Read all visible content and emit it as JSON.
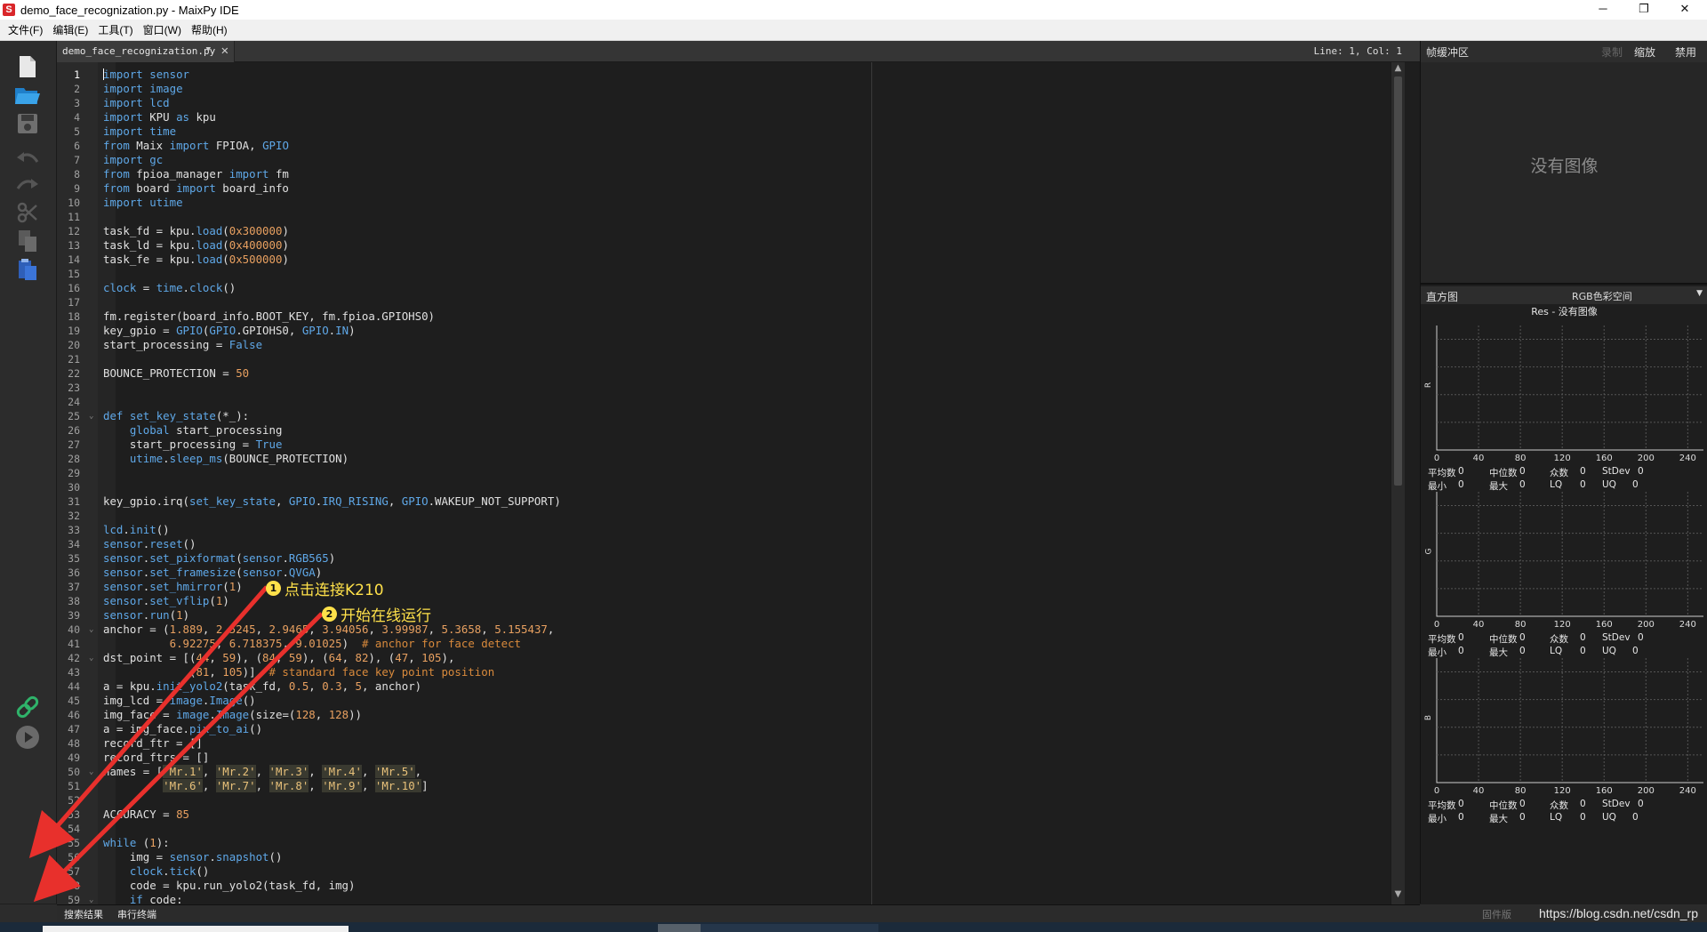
{
  "window": {
    "title": "demo_face_recognization.py - MaixPy IDE",
    "app_icon": "S",
    "minimize": "─",
    "restore": "❐",
    "close": "✕"
  },
  "menu": [
    "文件(F)",
    "编辑(E)",
    "工具(T)",
    "窗口(W)",
    "帮助(H)"
  ],
  "toolbar": {
    "new": "new-file-icon",
    "open": "open-folder-icon",
    "save": "save-icon",
    "undo": "undo-icon",
    "redo": "redo-icon",
    "cut": "cut-icon",
    "copy": "copy-icon",
    "paste": "paste-icon",
    "connect": "connect-link-icon",
    "run": "run-play-icon"
  },
  "editor": {
    "tab_name": "demo_face_recognization.py",
    "tab_dropdown": "▼",
    "tab_close": "✕",
    "cursor_position": "Line: 1, Col: 1",
    "lines": [
      "import sensor",
      "import image",
      "import lcd",
      "import KPU as kpu",
      "import time",
      "from Maix import FPIOA, GPIO",
      "import gc",
      "from fpioa_manager import fm",
      "from board import board_info",
      "import utime",
      "",
      "task_fd = kpu.load(0x300000)",
      "task_ld = kpu.load(0x400000)",
      "task_fe = kpu.load(0x500000)",
      "",
      "clock = time.clock()",
      "",
      "fm.register(board_info.BOOT_KEY, fm.fpioa.GPIOHS0)",
      "key_gpio = GPIO(GPIO.GPIOHS0, GPIO.IN)",
      "start_processing = False",
      "",
      "BOUNCE_PROTECTION = 50",
      "",
      "",
      "def set_key_state(*_):",
      "    global start_processing",
      "    start_processing = True",
      "    utime.sleep_ms(BOUNCE_PROTECTION)",
      "",
      "",
      "key_gpio.irq(set_key_state, GPIO.IRQ_RISING, GPIO.WAKEUP_NOT_SUPPORT)",
      "",
      "lcd.init()",
      "sensor.reset()",
      "sensor.set_pixformat(sensor.RGB565)",
      "sensor.set_framesize(sensor.QVGA)",
      "sensor.set_hmirror(1)",
      "sensor.set_vflip(1)",
      "sensor.run(1)",
      "anchor = (1.889, 2.5245, 2.9465, 3.94056, 3.99987, 5.3658, 5.155437,",
      "          6.92275, 6.718375, 9.01025)  # anchor for face detect",
      "dst_point = [(44, 59), (84, 59), (64, 82), (47, 105),",
      "             (81, 105)]  # standard face key point position",
      "a = kpu.init_yolo2(task_fd, 0.5, 0.3, 5, anchor)",
      "img_lcd = image.Image()",
      "img_face = image.Image(size=(128, 128))",
      "a = img_face.pix_to_ai()",
      "record_ftr = []",
      "record_ftrs = []",
      "names = ['Mr.1', 'Mr.2', 'Mr.3', 'Mr.4', 'Mr.5',",
      "         'Mr.6', 'Mr.7', 'Mr.8', 'Mr.9', 'Mr.10']",
      "",
      "ACCURACY = 85",
      "",
      "while (1):",
      "    img = sensor.snapshot()",
      "    clock.tick()",
      "    code = kpu.run_yolo2(task_fd, img)",
      "    if code:"
    ],
    "fold_lines": [
      25,
      40,
      42,
      50,
      55,
      59
    ],
    "fold_glyph": "⌄"
  },
  "scroll": {
    "up": "▲",
    "down": "▼"
  },
  "frame_buffer": {
    "title": "帧缓冲区",
    "record": "录制",
    "zoom": "缩放",
    "disable": "禁用",
    "no_image": "没有图像"
  },
  "histogram": {
    "title": "直方图",
    "color_space": "RGB色彩空间",
    "dropdown": "▼",
    "res_label": "Res - 没有图像",
    "tick_labels": [
      "0",
      "40",
      "80",
      "120",
      "160",
      "200",
      "240"
    ],
    "stat_labels": {
      "mean": "平均数",
      "median": "中位数",
      "mode": "众数",
      "stdev": "StDev",
      "min": "最小",
      "max": "最大",
      "lq": "LQ",
      "uq": "UQ"
    },
    "channels": [
      {
        "axis": "R",
        "mean": "0",
        "median": "0",
        "mode": "0",
        "stdev": "0",
        "min": "0",
        "max": "0",
        "lq": "0",
        "uq": "0"
      },
      {
        "axis": "G",
        "mean": "0",
        "median": "0",
        "mode": "0",
        "stdev": "0",
        "min": "0",
        "max": "0",
        "lq": "0",
        "uq": "0"
      },
      {
        "axis": "B",
        "mean": "0",
        "median": "0",
        "mode": "0",
        "stdev": "0",
        "min": "0",
        "max": "0",
        "lq": "0",
        "uq": "0"
      }
    ]
  },
  "bottom": {
    "search_results": "搜索结果",
    "serial_terminal": "串行终端",
    "firmware": "固件版",
    "watermark": "https://blog.csdn.net/csdn_rp"
  },
  "annotations": {
    "step1_num": "1",
    "step1_text": "点击连接K210",
    "step2_num": "2",
    "step2_text": "开始在线运行",
    "arrow_color": "#e8302c",
    "text_color": "#ffe14a"
  }
}
